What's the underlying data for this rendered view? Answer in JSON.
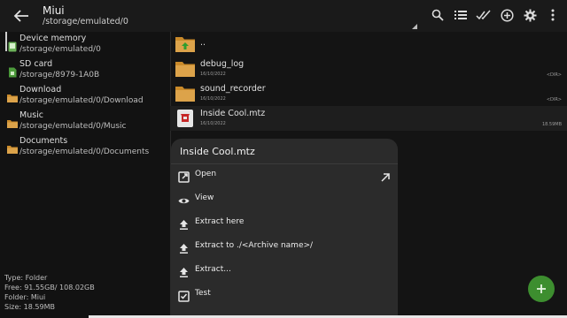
{
  "appbar": {
    "title": "Miui",
    "subtitle": "/storage/emulated/0",
    "actions": [
      "search-icon",
      "list-view-icon",
      "select-all-icon",
      "add-icon",
      "settings-icon",
      "more-icon"
    ]
  },
  "sidebar": {
    "items": [
      {
        "name": "Device memory",
        "path": "/storage/emulated/0",
        "icon": "device-memory-icon"
      },
      {
        "name": "SD card",
        "path": "/storage/8979-1A0B",
        "icon": "sd-card-icon"
      },
      {
        "name": "Download",
        "path": "/storage/emulated/0/Download",
        "icon": "folder-icon"
      },
      {
        "name": "Music",
        "path": "/storage/emulated/0/Music",
        "icon": "folder-icon"
      },
      {
        "name": "Documents",
        "path": "/storage/emulated/0/Documents",
        "icon": "folder-icon"
      }
    ],
    "info": {
      "type": "Type: Folder",
      "free": "Free: 91.55GB/ 108.02GB",
      "folder": "Folder: Miui",
      "size": "Size: 18.59MB"
    }
  },
  "files": [
    {
      "name": "..",
      "date": "",
      "meta": "",
      "icon": "parent-folder-icon"
    },
    {
      "name": "debug_log",
      "date": "16/10/2022",
      "meta": "<DIR>",
      "icon": "folder-icon"
    },
    {
      "name": "sound_recorder",
      "date": "16/10/2022",
      "meta": "<DIR>",
      "icon": "folder-icon"
    },
    {
      "name": "Inside Cool.mtz",
      "date": "16/10/2022",
      "meta": "18.59MB",
      "icon": "archive-file-icon"
    }
  ],
  "dialog": {
    "title": "Inside Cool.mtz",
    "items": [
      {
        "label": "Open",
        "icon": "open-external-icon"
      },
      {
        "label": "View",
        "icon": "eye-icon"
      },
      {
        "label": "Extract here",
        "icon": "extract-icon"
      },
      {
        "label": "Extract to ./<Archive name>/",
        "icon": "extract-icon"
      },
      {
        "label": "Extract...",
        "icon": "extract-icon"
      },
      {
        "label": "Test",
        "icon": "checkbox-icon"
      }
    ]
  },
  "colors": {
    "background": "#121212",
    "dialog": "#2b2b2b",
    "folder": "#c98a2a",
    "fab": "#3d8e2f",
    "archive": "#c62828"
  }
}
